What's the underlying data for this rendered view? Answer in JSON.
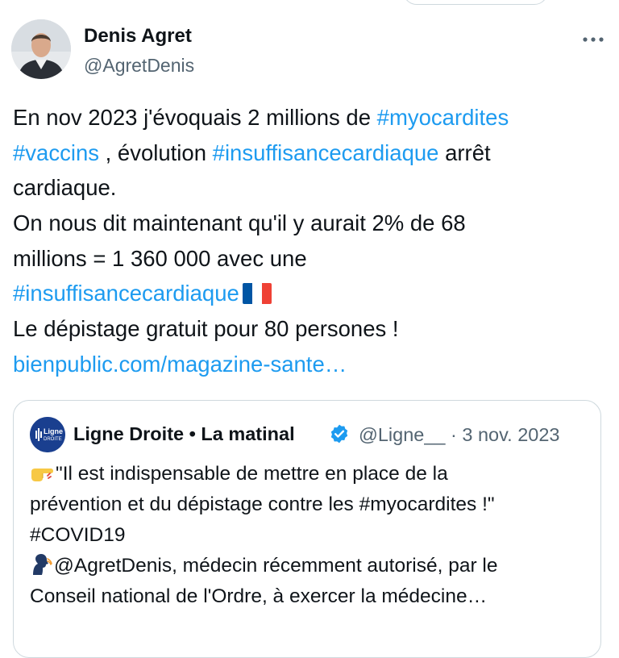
{
  "author": {
    "name": "Denis Agret",
    "handle": "@AgretDenis",
    "avatar_icon": "profile-photo"
  },
  "more_icon": "more-horizontal-icon",
  "tweet": {
    "lines": [
      [
        {
          "t": "En nov 2023 j'évoquais 2 millions de ",
          "k": "text"
        },
        {
          "t": "#myocardites",
          "k": "hashtag"
        }
      ],
      [
        {
          "t": "#vaccins",
          "k": "hashtag"
        },
        {
          "t": " , évolution ",
          "k": "text"
        },
        {
          "t": "#insuffisancecardiaque",
          "k": "hashtag"
        },
        {
          "t": " arrêt",
          "k": "text"
        }
      ],
      [
        {
          "t": "cardiaque.",
          "k": "text"
        }
      ],
      [
        {
          "t": "On nous dit maintenant qu'il y aurait 2% de 68",
          "k": "text"
        }
      ],
      [
        {
          "t": "millions = 1 360 000 avec une",
          "k": "text"
        }
      ],
      [
        {
          "t": "#insuffisancecardiaque",
          "k": "hashtag"
        }
      ],
      [
        {
          "t": "Le dépistage gratuit pour 80 persones !",
          "k": "text"
        }
      ],
      [
        {
          "t": "bienpublic.com/magazine-sante…",
          "k": "link"
        }
      ]
    ],
    "flag_icon": "france-flag-icon"
  },
  "quote": {
    "name": "Ligne Droite • La matinal",
    "handle": "@Ligne__",
    "separator": "·",
    "date": "3 nov. 2023",
    "avatar_label_1": "Ligne",
    "avatar_label_2": "DROITE",
    "verified_icon": "verified-badge-icon",
    "lines": [
      {
        "emoji": "pointing-hand-icon",
        "t": "\"Il est indispensable de mettre en place de la"
      },
      {
        "t": "prévention et du dépistage contre les #myocardites !\""
      },
      {
        "t": "#COVID19"
      },
      {
        "emoji": "speaking-head-icon",
        "t": "@AgretDenis, médecin récemment autorisé, par le"
      },
      {
        "t": "Conseil national de l'Ordre, à exercer la médecine…"
      }
    ]
  },
  "colors": {
    "text": "#0f1419",
    "secondary": "#536471",
    "link": "#1d9bf0",
    "border": "#cfd9de",
    "verified": "#1d9bf0"
  }
}
